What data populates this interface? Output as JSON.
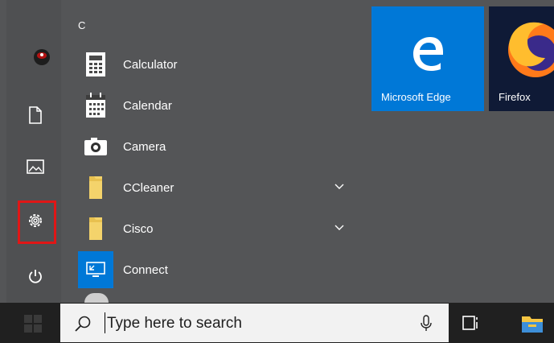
{
  "start_menu": {
    "section_letter": "C",
    "apps": [
      {
        "label": "Calculator",
        "icon": "calculator-icon",
        "expandable": false
      },
      {
        "label": "Calendar",
        "icon": "calendar-icon",
        "expandable": false
      },
      {
        "label": "Camera",
        "icon": "camera-icon",
        "expandable": false
      },
      {
        "label": "CCleaner",
        "icon": "folder-icon",
        "expandable": true
      },
      {
        "label": "Cisco",
        "icon": "folder-icon",
        "expandable": true
      },
      {
        "label": "Connect",
        "icon": "connect-icon",
        "expandable": false
      }
    ],
    "left_rail": {
      "items": [
        "user-avatar",
        "documents-icon",
        "pictures-icon",
        "settings-icon",
        "power-icon"
      ],
      "highlight_color": "#e01616"
    },
    "tiles": [
      {
        "label": "Microsoft Edge",
        "color": "#0078d7",
        "icon": "edge-icon"
      },
      {
        "label": "Firefox",
        "color": "#0f1a36",
        "icon": "firefox-icon"
      }
    ]
  },
  "taskbar": {
    "search_placeholder": "Type here to search",
    "icons": [
      "windows-icon",
      "search-icon",
      "microphone-icon",
      "task-view-icon",
      "file-explorer-icon"
    ]
  },
  "colors": {
    "menu_bg": "#545557",
    "taskbar_bg": "#202020",
    "edge_tile": "#0078d7",
    "folder_yellow": "#f4d36b"
  }
}
